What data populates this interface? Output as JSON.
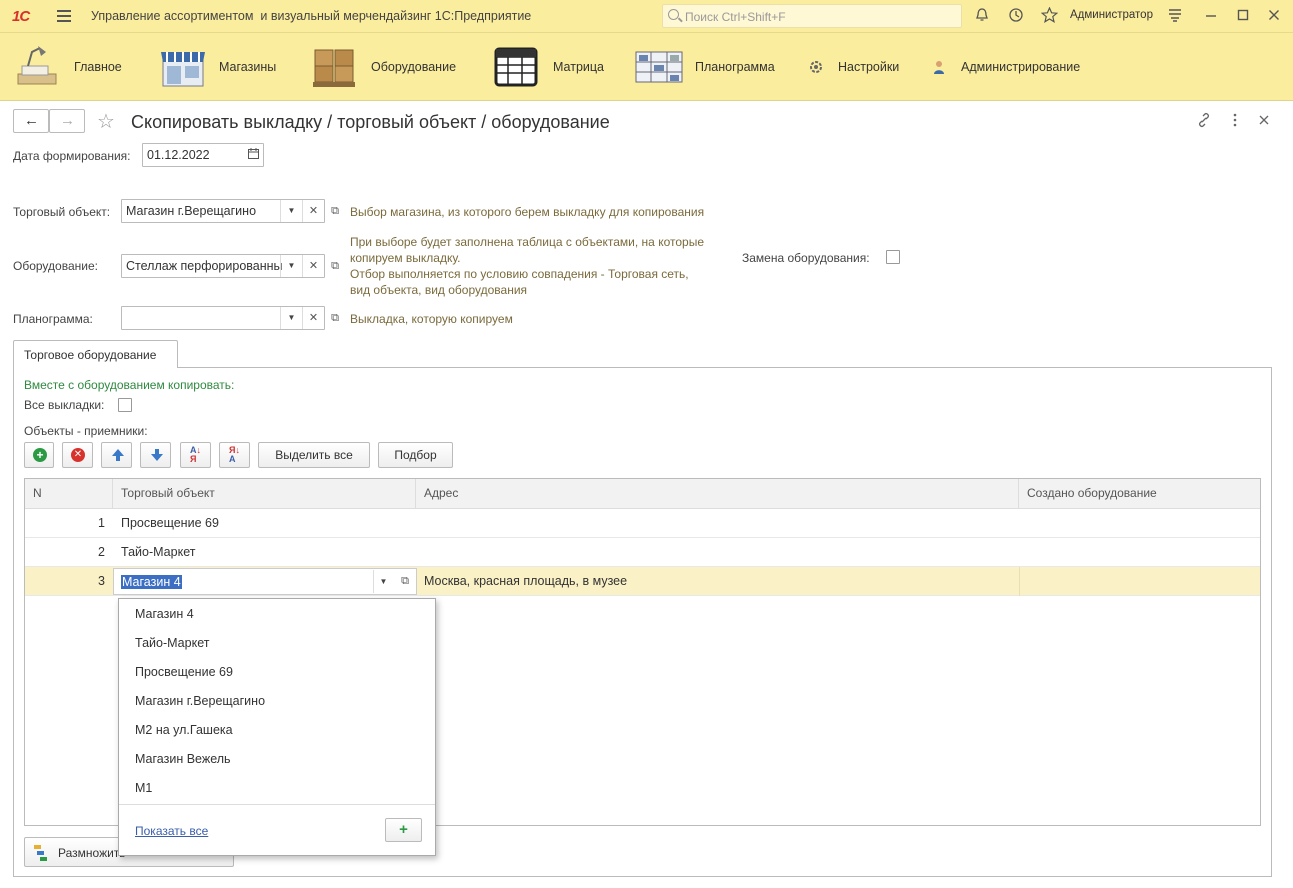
{
  "titlebar": {
    "logo": "1С",
    "app_title": "Управление ассортиментом  и визуальный мерчендайзинг 1С:Предприятие",
    "search_placeholder": "Поиск Ctrl+Shift+F",
    "user": "Администратор"
  },
  "sections": [
    {
      "label": "Главное",
      "icon": "desk-lamp-icon"
    },
    {
      "label": "Магазины",
      "icon": "storefront-icon"
    },
    {
      "label": "Оборудование",
      "icon": "pallet-boxes-icon"
    },
    {
      "label": "Матрица",
      "icon": "spreadsheet-icon"
    },
    {
      "label": "Планограмма",
      "icon": "planogram-icon"
    },
    {
      "label": "Настройки",
      "icon": "gear-icon"
    },
    {
      "label": "Администрирование",
      "icon": "user-icon"
    }
  ],
  "form": {
    "title": "Скопировать выкладку / торговый объект / оборудование",
    "date_label": "Дата формирования:",
    "date_value": "01.12.2022",
    "store_label": "Торговый объект:",
    "store_value": "Магазин г.Верещагино",
    "store_hint": "Выбор магазина, из которого берем выкладку для копирования",
    "equipment_label": "Оборудование:",
    "equipment_value": "Стеллаж перфорированный",
    "equipment_hint_1": "При выборе будет заполнена таблица с объектами, на которые",
    "equipment_hint_2": "копируем выкладку.",
    "equipment_hint_3": "Отбор выполняется по условию совпадения - Торговая сеть,",
    "equipment_hint_4": "вид объекта, вид оборудования",
    "replace_label": "Замена оборудования:",
    "planogram_label": "Планограмма:",
    "planogram_value": "",
    "planogram_hint": "Выкладка, которую копируем"
  },
  "tab": {
    "label": "Торговое оборудование",
    "copy_with": "Вместе с оборудованием копировать:",
    "all_layouts_label": "Все выкладки:",
    "receivers_label": "Объекты - приемники:",
    "select_all": "Выделить все",
    "pick": "Подбор"
  },
  "table": {
    "columns": [
      "N",
      "Торговый объект",
      "Адрес",
      "Создано оборудование"
    ],
    "rows": [
      {
        "n": "1",
        "store": "Просвещение 69",
        "address": "",
        "created": ""
      },
      {
        "n": "2",
        "store": "Тайо-Маркет",
        "address": "",
        "created": ""
      },
      {
        "n": "3",
        "store": "Магазин 4",
        "address": "Москва, красная площадь, в музее",
        "created": ""
      }
    ]
  },
  "dropdown": {
    "items": [
      "Магазин 4",
      "Тайо-Маркет",
      "Просвещение 69",
      "Магазин г.Верещагино",
      "М2 на ул.Гашека",
      "Магазин Вежель",
      "М1"
    ],
    "show_all": "Показать все"
  },
  "bottom_button": "Размножить",
  "colors": {
    "accent": "#fbed9e",
    "active_row": "#fbf1c6",
    "hint": "#7a6a3c",
    "green_hint": "#2f8a40"
  }
}
